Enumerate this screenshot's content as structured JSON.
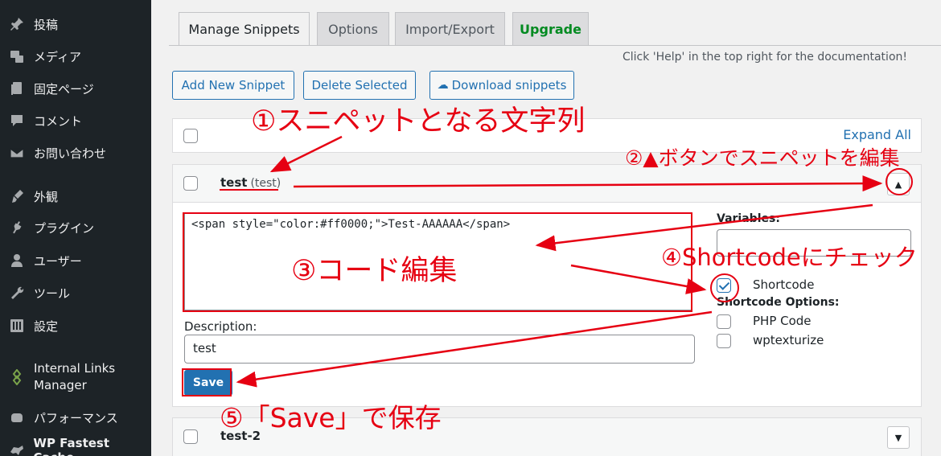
{
  "sidebar": {
    "items": [
      {
        "label": "投稿",
        "icon": "pin-icon"
      },
      {
        "label": "メディア",
        "icon": "media-icon"
      },
      {
        "label": "固定ページ",
        "icon": "page-icon"
      },
      {
        "label": "コメント",
        "icon": "comment-icon"
      },
      {
        "label": "お問い合わせ",
        "icon": "mail-icon"
      },
      {
        "label": "外観",
        "icon": "brush-icon"
      },
      {
        "label": "プラグイン",
        "icon": "plugin-icon"
      },
      {
        "label": "ユーザー",
        "icon": "user-icon"
      },
      {
        "label": "ツール",
        "icon": "wrench-icon"
      },
      {
        "label": "設定",
        "icon": "settings-icon"
      },
      {
        "label": "Internal Links Manager",
        "icon": "link-manager-icon"
      },
      {
        "label": "パフォーマンス",
        "icon": "performance-icon"
      },
      {
        "label": "WP Fastest Cache",
        "icon": "cheetah-icon"
      }
    ]
  },
  "tabs": {
    "manage": "Manage Snippets",
    "options": "Options",
    "import_export": "Import/Export",
    "upgrade": "Upgrade"
  },
  "help_note": "Click 'Help' in the top right for the documentation!",
  "toolbar": {
    "add_new": "Add New Snippet",
    "delete_selected": "Delete Selected",
    "download": "Download snippets"
  },
  "list": {
    "expand_all": "Expand All"
  },
  "snippet1": {
    "name": "test",
    "sub": "(test)",
    "toggle": "▲",
    "code": "<span style=\"color:#ff0000;\">Test-AAAAAA</span>",
    "variables_label": "Variables:",
    "shortcode_label": "Shortcode",
    "shortcode_checked": true,
    "shortcode_options_label": "Shortcode Options:",
    "php_code_label": "PHP Code",
    "wptexturize_label": "wptexturize",
    "description_label": "Description:",
    "description_value": "test",
    "save_label": "Save"
  },
  "snippet2": {
    "name": "test-2",
    "toggle": "▼"
  },
  "annotations": {
    "a1": "①スニペットとなる文字列",
    "a2": "②▲ボタンでスニペットを編集",
    "a3": "③コード編集",
    "a4": "④Shortcodeにチェック",
    "a5": "⑤「Save」で保存"
  },
  "colors": {
    "annotation": "#e60012",
    "primary": "#2271b1",
    "sidebar_bg": "#1d2327",
    "upgrade": "#008a20"
  }
}
